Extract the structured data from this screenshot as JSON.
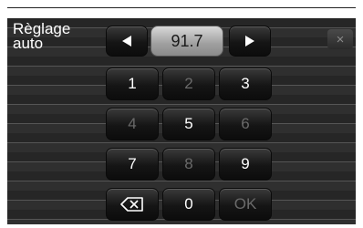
{
  "title": {
    "line1": "Règlage",
    "line2": "auto"
  },
  "frequency": "91.7",
  "keypad": {
    "k1": "1",
    "k2": "2",
    "k3": "3",
    "k4": "4",
    "k5": "5",
    "k6": "6",
    "k7": "7",
    "k8": "8",
    "k9": "9",
    "k0": "0",
    "ok": "OK"
  },
  "disabled_keys": [
    "2",
    "4",
    "6",
    "8",
    "OK"
  ],
  "icons": {
    "prev": "left-arrow-icon",
    "next": "right-arrow-icon",
    "backspace": "backspace-icon",
    "close": "close-icon"
  },
  "close_glyph": "×",
  "colors": {
    "screen_bg": "#2b2b2b",
    "key_text": "#ffffff",
    "key_text_disabled": "#6a6a6a",
    "display_bg": "#b0b0b0"
  }
}
